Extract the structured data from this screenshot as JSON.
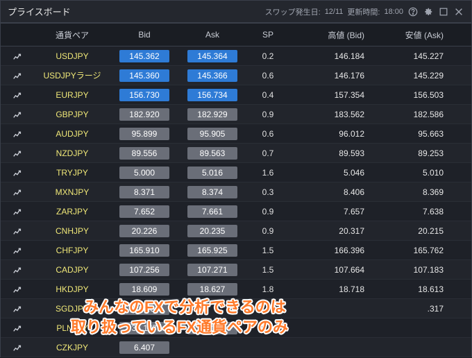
{
  "titlebar": {
    "title": "プライスボード",
    "swap_label": "スワップ発生日: ",
    "swap_date": "12/11",
    "update_label": " 更新時間: ",
    "update_time": "18:00"
  },
  "columns": {
    "pair": "通貨ペア",
    "bid": "Bid",
    "ask": "Ask",
    "sp": "SP",
    "high": "高値 (Bid)",
    "low": "安値 (Ask)"
  },
  "rows": [
    {
      "pair": "USDJPY",
      "bid": "145.362",
      "ask": "145.364",
      "sp": "0.2",
      "high": "146.184",
      "low": "145.227",
      "highlight": true
    },
    {
      "pair": "USDJPYラージ",
      "bid": "145.360",
      "ask": "145.366",
      "sp": "0.6",
      "high": "146.176",
      "low": "145.229",
      "highlight": true
    },
    {
      "pair": "EURJPY",
      "bid": "156.730",
      "ask": "156.734",
      "sp": "0.4",
      "high": "157.354",
      "low": "156.503",
      "highlight": true
    },
    {
      "pair": "GBPJPY",
      "bid": "182.920",
      "ask": "182.929",
      "sp": "0.9",
      "high": "183.562",
      "low": "182.586",
      "highlight": false
    },
    {
      "pair": "AUDJPY",
      "bid": "95.899",
      "ask": "95.905",
      "sp": "0.6",
      "high": "96.012",
      "low": "95.663",
      "highlight": false
    },
    {
      "pair": "NZDJPY",
      "bid": "89.556",
      "ask": "89.563",
      "sp": "0.7",
      "high": "89.593",
      "low": "89.253",
      "highlight": false
    },
    {
      "pair": "TRYJPY",
      "bid": "5.000",
      "ask": "5.016",
      "sp": "1.6",
      "high": "5.046",
      "low": "5.010",
      "highlight": false
    },
    {
      "pair": "MXNJPY",
      "bid": "8.371",
      "ask": "8.374",
      "sp": "0.3",
      "high": "8.406",
      "low": "8.369",
      "highlight": false
    },
    {
      "pair": "ZARJPY",
      "bid": "7.652",
      "ask": "7.661",
      "sp": "0.9",
      "high": "7.657",
      "low": "7.638",
      "highlight": false
    },
    {
      "pair": "CNHJPY",
      "bid": "20.226",
      "ask": "20.235",
      "sp": "0.9",
      "high": "20.317",
      "low": "20.215",
      "highlight": false
    },
    {
      "pair": "CHFJPY",
      "bid": "165.910",
      "ask": "165.925",
      "sp": "1.5",
      "high": "166.396",
      "low": "165.762",
      "highlight": false
    },
    {
      "pair": "CADJPY",
      "bid": "107.256",
      "ask": "107.271",
      "sp": "1.5",
      "high": "107.664",
      "low": "107.183",
      "highlight": false
    },
    {
      "pair": "HKDJPY",
      "bid": "18.609",
      "ask": "18.627",
      "sp": "1.8",
      "high": "18.718",
      "low": "18.613",
      "highlight": false
    },
    {
      "pair": "SGDJPY",
      "bid": "108.3",
      "ask": "",
      "sp": "",
      "high": "",
      "low": ".317",
      "highlight": false
    },
    {
      "pair": "PLNJPY",
      "bid": "36.167",
      "ask": "36.195",
      "sp": "",
      "high": "",
      "low": "",
      "highlight": false
    },
    {
      "pair": "CZKJPY",
      "bid": "6.407",
      "ask": "",
      "sp": "",
      "high": "",
      "low": "",
      "highlight": false
    }
  ],
  "overlay": {
    "line1": "みんなのFXで分析できるのは",
    "line2": "取り扱っているFX通貨ペアのみ"
  }
}
